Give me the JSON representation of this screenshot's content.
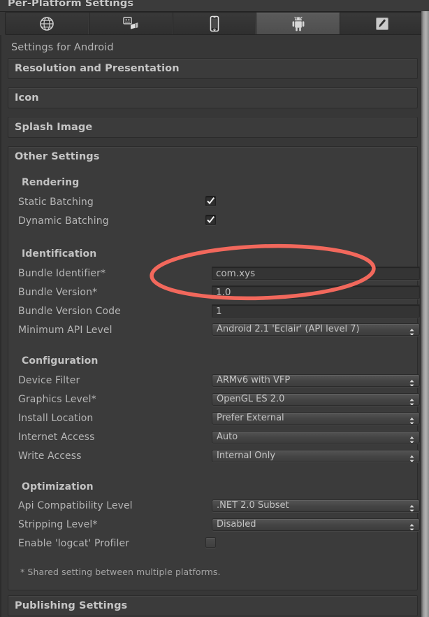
{
  "window": {
    "title": "Per-Platform Settings"
  },
  "platform_tabs": [
    {
      "name": "web-player",
      "icon": "globe-icon",
      "active": false
    },
    {
      "name": "standalone",
      "icon": "windows-icon",
      "active": false
    },
    {
      "name": "ios",
      "icon": "iphone-icon",
      "active": false
    },
    {
      "name": "android",
      "icon": "android-icon",
      "active": true
    },
    {
      "name": "flash",
      "icon": "flash-tool-icon",
      "active": false
    }
  ],
  "settings_for": "Settings for Android",
  "collapsed_sections": [
    {
      "label": "Resolution and Presentation"
    },
    {
      "label": "Icon"
    },
    {
      "label": "Splash Image"
    }
  ],
  "other_settings": {
    "title": "Other Settings",
    "groups": [
      {
        "heading": "Rendering",
        "rows": [
          {
            "label": "Static Batching",
            "control": "checkbox",
            "value": "checked"
          },
          {
            "label": "Dynamic Batching",
            "control": "checkbox",
            "value": "checked"
          }
        ]
      },
      {
        "heading": "Identification",
        "rows": [
          {
            "label": "Bundle Identifier*",
            "control": "textfield",
            "value": "com.xys"
          },
          {
            "label": "Bundle Version*",
            "control": "textfield",
            "value": "1.0"
          },
          {
            "label": "Bundle Version Code",
            "control": "textfield",
            "value": "1"
          },
          {
            "label": "Minimum API Level",
            "control": "dropdown",
            "value": "Android 2.1 'Eclair' (API level 7)"
          }
        ]
      },
      {
        "heading": "Configuration",
        "rows": [
          {
            "label": "Device Filter",
            "control": "dropdown",
            "value": "ARMv6 with VFP"
          },
          {
            "label": "Graphics Level*",
            "control": "dropdown",
            "value": "OpenGL ES 2.0"
          },
          {
            "label": "Install Location",
            "control": "dropdown",
            "value": "Prefer External"
          },
          {
            "label": "Internet Access",
            "control": "dropdown",
            "value": "Auto"
          },
          {
            "label": "Write Access",
            "control": "dropdown",
            "value": "Internal Only"
          }
        ]
      },
      {
        "heading": "Optimization",
        "rows": [
          {
            "label": "Api Compatibility Level",
            "control": "dropdown",
            "value": ".NET 2.0 Subset"
          },
          {
            "label": "Stripping Level*",
            "control": "dropdown",
            "value": "Disabled"
          },
          {
            "label": "Enable 'logcat' Profiler",
            "control": "checkbox",
            "value": "unchecked"
          }
        ]
      }
    ],
    "footnote": "* Shared setting between multiple platforms."
  },
  "publishing_section": {
    "label": "Publishing Settings"
  },
  "annotation": {
    "shape": "ellipse-highlight",
    "target": "Bundle Identifier field",
    "color": "#f2685c"
  },
  "colors": {
    "panel_bg": "#373737",
    "section_bg": "#3b3b3b",
    "field_bg": "#343434",
    "text": "#b6b6b6",
    "accent": "#f2685c"
  }
}
